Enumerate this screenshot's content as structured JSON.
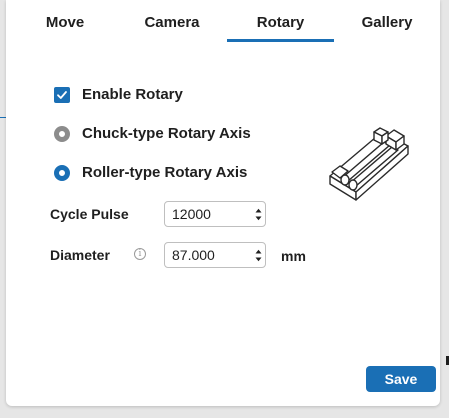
{
  "tabs": [
    {
      "label": "Move",
      "active": false
    },
    {
      "label": "Camera",
      "active": false
    },
    {
      "label": "Rotary",
      "active": true
    },
    {
      "label": "Gallery",
      "active": false
    }
  ],
  "enable_rotary": {
    "label": "Enable Rotary",
    "checked": true
  },
  "axis_type": {
    "chuck_label": "Chuck-type Rotary Axis",
    "roller_label": "Roller-type Rotary Axis",
    "selected": "roller"
  },
  "cycle_pulse": {
    "label": "Cycle Pulse",
    "value": "12000"
  },
  "diameter": {
    "label": "Diameter",
    "value": "87.000",
    "unit": "mm"
  },
  "save_label": "Save",
  "colors": {
    "accent": "#1a6fb5",
    "radio_unselected": "#8c8c8c"
  },
  "icons": {
    "checkbox": "check-icon",
    "info": "info-icon",
    "spinner": "chevron-up-down-icon",
    "device": "roller-rotary-device-image"
  }
}
